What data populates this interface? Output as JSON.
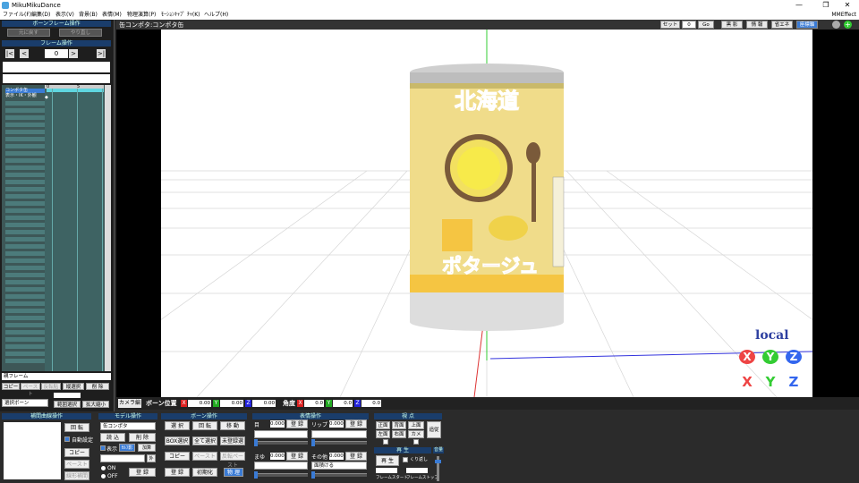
{
  "window": {
    "title": "MikuMikuDance",
    "minimize": "—",
    "restore": "❐",
    "close": "✕"
  },
  "menu": {
    "items": [
      "ファイル(F)",
      "編集(D)",
      "表示(V)",
      "背景(B)",
      "表情(M)",
      "物理演算(P)",
      "ﾓｰｼｮﾝｷｬﾌﾟ ﾁｬ(K)",
      "ヘルプ(H)"
    ],
    "right": "MMEffect"
  },
  "left_panel": {
    "bone_frame_title": "ボーンフレーム操作",
    "undo": "元に戻す",
    "redo": "やり直し",
    "frame_title": "フレーム操作",
    "frame_value": "0",
    "nav": [
      "|<",
      "<",
      ">",
      ">|"
    ],
    "timeline_header": "0",
    "timeline_header2": "5",
    "rows": [
      "コンポタ缶",
      "表示・IK・外観"
    ],
    "footer_label": "親フレーム",
    "copy": "コピー",
    "paste": "ペースト",
    "reverse": "反転貼",
    "vertical_select": "縦選択",
    "delete": "削 除",
    "bone_select": "選択ボーン",
    "range_select": "範囲選択",
    "zoom": "拡大縮小"
  },
  "viewport": {
    "header_label": "缶コンポタ:コンポタ缶",
    "set_label": "セット",
    "set_value": "0",
    "go": "Go",
    "shadow": "黒 影",
    "info": "情 報",
    "energy": "省エネ",
    "coord": "座標軸",
    "local": "local",
    "can_top_text": "北海道",
    "can_bottom_text": "ポタージュ"
  },
  "camera_bar": {
    "camera_tab": "カメラ編",
    "bone_pos": "ボーン位置",
    "x": "X",
    "y": "Y",
    "z": "Z",
    "x_val": "0.00",
    "y_val": "0.00",
    "z_val": "0.00",
    "angle": "角度",
    "ax": "X",
    "ay": "Y",
    "az": "Z",
    "ax_val": "0.0",
    "ay_val": "0.0",
    "az_val": "0.0"
  },
  "bottom": {
    "interp_title": "補間曲線操作",
    "rotate": "回 転",
    "auto": "自動設定",
    "copy": "コピー",
    "paste": "ペースト",
    "linear": "線形補間",
    "model_title": "モデル操作",
    "model_select": "缶コンポタ",
    "load": "読 込",
    "delete": "削 除",
    "display": "表示",
    "shadow": "ｾﾙﾌ影",
    "add": "加算",
    "outside": "外",
    "on": "ON",
    "off": "OFF",
    "register": "登 録",
    "bone_title": "ボーン操作",
    "select": "選 択",
    "rot": "回 転",
    "move": "移 動",
    "box_select": "BOX選択",
    "all_select": "全て選択",
    "unreg_select": "未登録選",
    "b_copy": "コピー",
    "b_paste": "ペースト",
    "b_reverse": "反転ペースト",
    "b_register": "登 録",
    "init": "初期化",
    "physics": "物 理",
    "face_title": "表情操作",
    "eye": "目",
    "eye_val": "0.000",
    "lip": "リップ",
    "lip_val": "0.000",
    "brow": "まゆ",
    "brow_val": "0.000",
    "other": "その他",
    "other_val": "0.000",
    "other_select": "面積ける",
    "f_register": "登 録",
    "view_title": "視 点",
    "front": "正面",
    "back": "背面",
    "top": "上面",
    "left": "左面",
    "right": "右面",
    "camera": "カメラ",
    "follow": "追従",
    "play_title": "再 生",
    "play": "再 生",
    "repeat": "くり返し",
    "frame_start": "フレームスタート",
    "frame_stop": "フレームストップ",
    "volume": "音量"
  },
  "colors": {
    "accent": "#1a3d6b",
    "timeline_strip": "#4c7b7b",
    "axis_x": "#d22",
    "axis_y": "#2a2",
    "axis_z": "#22d",
    "local_text": "#2d3fa0"
  }
}
